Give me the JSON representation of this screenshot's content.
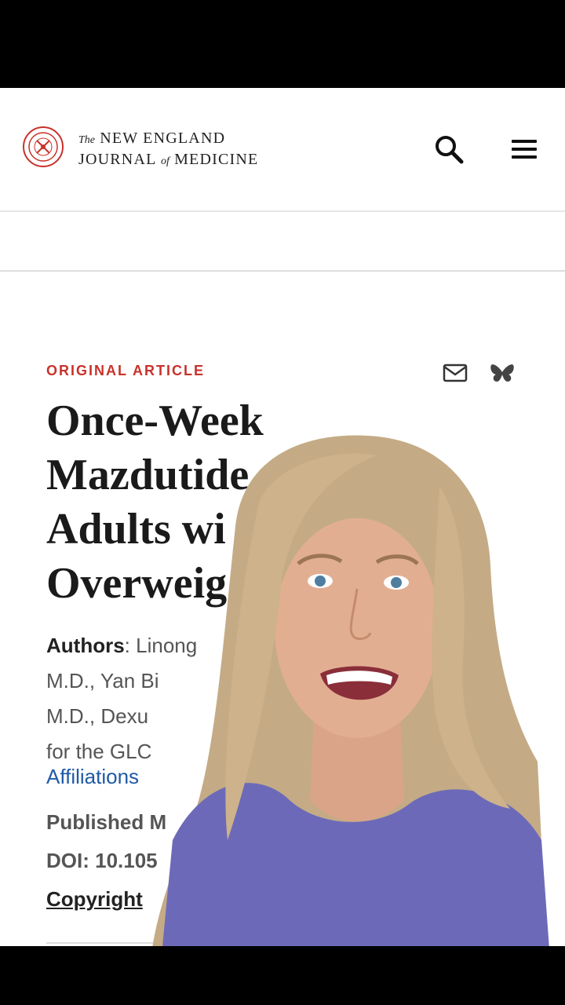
{
  "header": {
    "brand_the": "The",
    "brand_line1": "NEW ENGLAND",
    "brand_journal": "JOURNAL",
    "brand_of": "of",
    "brand_medicine": "MEDICINE",
    "search_icon": "search-icon",
    "menu_icon": "hamburger-menu-icon"
  },
  "article": {
    "kicker": "ORIGINAL ARTICLE",
    "title_lines": [
      "Once-Week",
      "Mazdutide",
      "Adults wi",
      "Overweig"
    ],
    "authors_label": "Authors",
    "authors_lines": [
      ": Linong",
      "M.D., Yan Bi",
      "M.D., Dexu",
      "for the GLC"
    ],
    "affiliations": "Affiliations",
    "published": "Published M",
    "doi": "DOI: 10.105",
    "copyright": "Copyright"
  },
  "share": {
    "mail_icon": "mail-icon",
    "bluesky_icon": "bluesky-butterfly-icon"
  },
  "colors": {
    "accent_red": "#c8322a",
    "link_blue": "#1f5aa6",
    "shirt_purple": "#6c6ab8",
    "hair_blonde": "#c9b08a"
  }
}
